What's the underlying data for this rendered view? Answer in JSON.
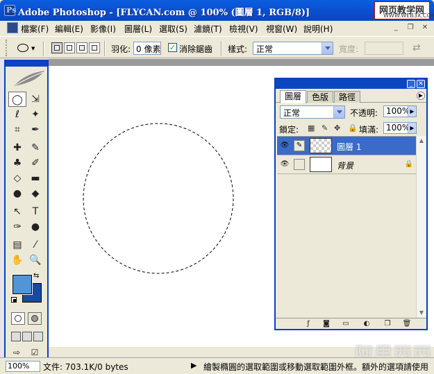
{
  "window": {
    "title": "Adobe Photoshop - [FLYCAN.com @ 100% (圖層 1, RGB/8)]",
    "watermark_line1": "网页教学网",
    "watermark_line2": "WWW.WEB3X.COM"
  },
  "menu": {
    "items": [
      "檔案(F)",
      "編輯(E)",
      "影像(I)",
      "圖層(L)",
      "選取(S)",
      "濾鏡(T)",
      "檢視(V)",
      "視窗(W)",
      "說明(H)"
    ],
    "window_controls": [
      "_",
      "❐",
      "✕"
    ]
  },
  "options": {
    "feather_label": "羽化:",
    "feather_value": "0 像素",
    "antialias_label": "消除鋸齒",
    "antialias_checked": "✓",
    "style_label": "樣式:",
    "style_value": "正常",
    "width_label": "寬度:",
    "swap_icon": "⇄"
  },
  "toolbox": {
    "tools": [
      "◯",
      "⇲",
      "ℓ",
      "✦",
      "⌗",
      "✒",
      "✚",
      "✎",
      "♣",
      "✐",
      "◇",
      "▬",
      "●",
      "◆",
      "↖",
      "T",
      "✑",
      "●",
      "▤",
      "⁄",
      "✋",
      "🔍"
    ],
    "foreground_color": "#4f95d8",
    "background_color": "#1a4aa0"
  },
  "status": {
    "zoom": "100%",
    "docsize": "文件: 703.1K/0 bytes",
    "hint": "繪製橢圓的選取範圍或移動選取範圍外框。額外的選項請使用"
  },
  "layers_panel": {
    "tabs": [
      "圖層",
      "色版",
      "路徑"
    ],
    "blend_mode": "正常",
    "opacity_label": "不透明:",
    "opacity_value": "100%",
    "lock_label": "鎖定:",
    "fill_label": "填滿:",
    "fill_value": "100%",
    "layers": [
      {
        "name": "圖層 1",
        "selected": true
      },
      {
        "name": "背景",
        "selected": false
      }
    ]
  },
  "brand_watermark": "阿里西西"
}
